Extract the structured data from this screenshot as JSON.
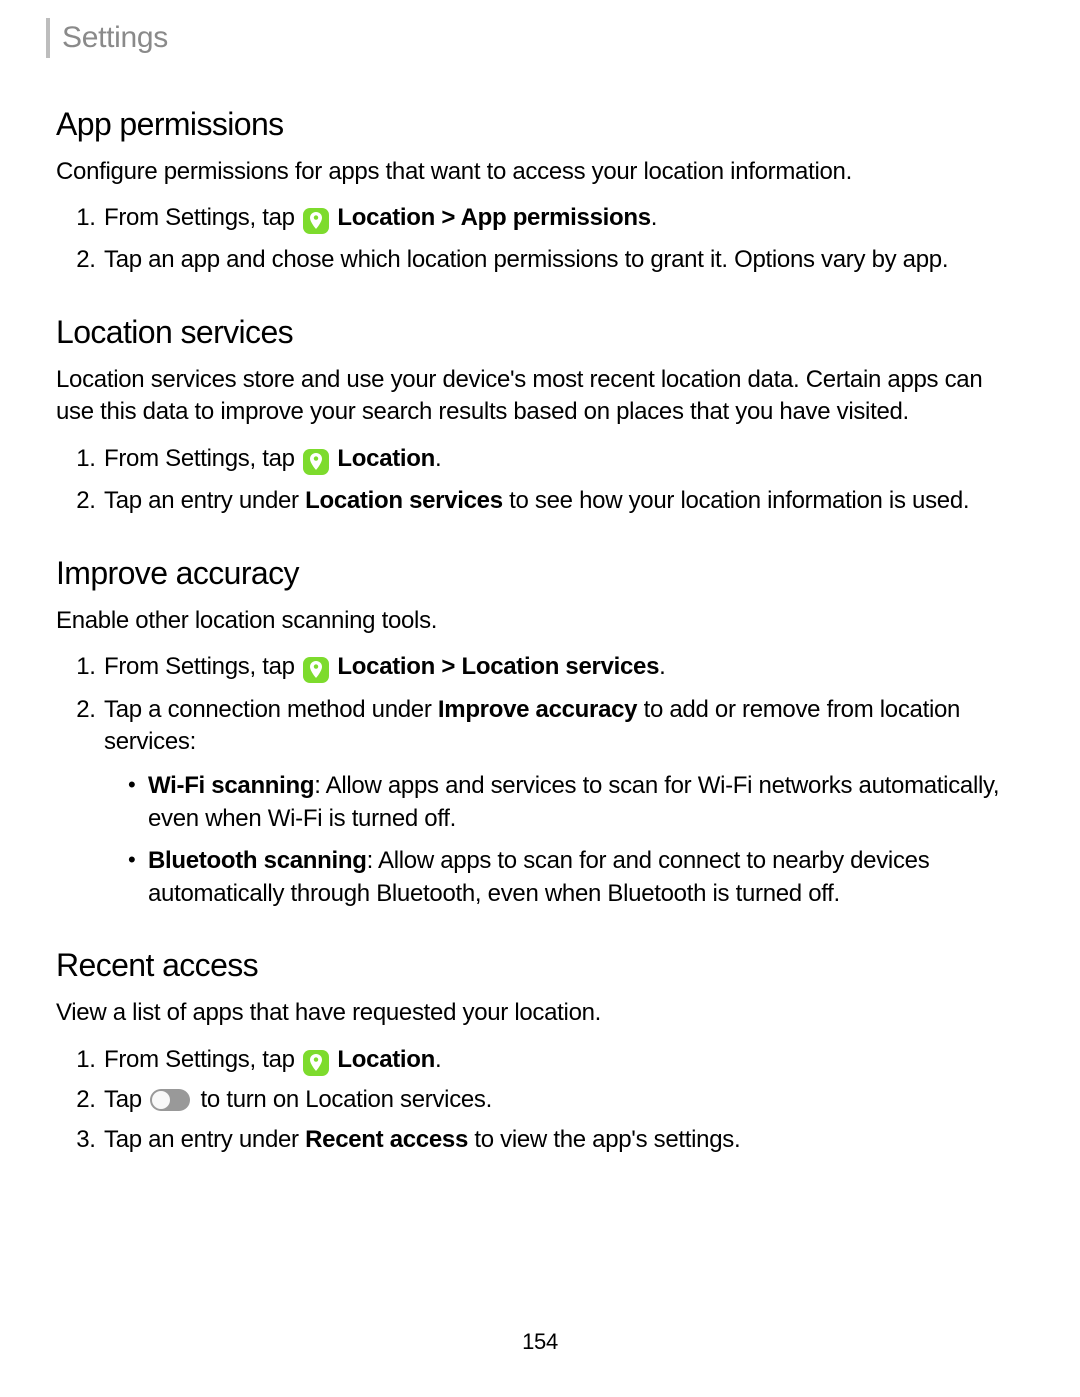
{
  "header": {
    "title": "Settings"
  },
  "page_number": "154",
  "sec1": {
    "heading": "App permissions",
    "intro": "Configure permissions for apps that want to access your location information.",
    "step1_pre": "From Settings, tap ",
    "step1_bold": "Location > App permissions",
    "step1_post": ".",
    "step2": "Tap an app and chose which location permissions to grant it. Options vary by app."
  },
  "sec2": {
    "heading": "Location services",
    "intro": "Location services store and use your device's most recent location data. Certain apps can use this data to improve your search results based on places that you have visited.",
    "step1_pre": "From Settings, tap ",
    "step1_bold": "Location",
    "step1_post": ".",
    "step2_a": "Tap an entry under ",
    "step2_b": "Location services",
    "step2_c": " to see how your location information is used."
  },
  "sec3": {
    "heading": "Improve accuracy",
    "intro": "Enable other location scanning tools.",
    "step1_pre": "From Settings, tap ",
    "step1_bold": "Location > Location services",
    "step1_post": ".",
    "step2_a": "Tap a connection method under ",
    "step2_b": "Improve accuracy",
    "step2_c": " to add or remove from location services:",
    "b1_bold": "Wi-Fi scanning",
    "b1_rest": ": Allow apps and services to scan for Wi-Fi networks automatically, even when Wi-Fi is turned off.",
    "b2_bold": "Bluetooth scanning",
    "b2_rest": ": Allow apps to scan for and connect to nearby devices automatically through Bluetooth, even when Bluetooth is turned off."
  },
  "sec4": {
    "heading": "Recent access",
    "intro": "View a list of apps that have requested your location.",
    "step1_pre": "From Settings, tap ",
    "step1_bold": "Location",
    "step1_post": ".",
    "step2_a": "Tap ",
    "step2_b": " to turn on Location services.",
    "step3_a": "Tap an entry under ",
    "step3_b": "Recent access",
    "step3_c": " to view the app's settings."
  }
}
